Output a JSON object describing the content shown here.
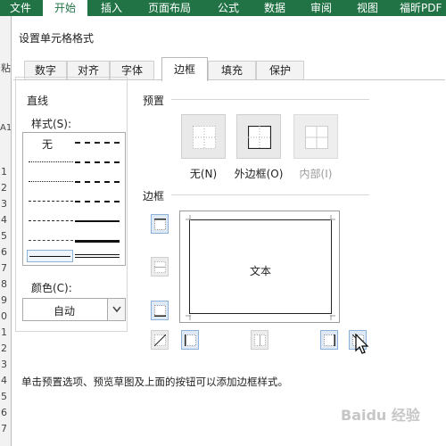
{
  "ribbon": {
    "file_tab": "文件",
    "tabs": [
      "开始",
      "插入",
      "页面布局",
      "公式",
      "数据",
      "审阅",
      "视图",
      "福昕PDF"
    ]
  },
  "sheet": {
    "name_box_fragment": "粘",
    "cell_ref_fragment": "A1",
    "row_numbers": [
      "1",
      "2",
      "3",
      "4",
      "5",
      "6",
      "7",
      "8",
      "9",
      "0",
      "1",
      "2",
      "3",
      "4",
      "5",
      "6",
      "7"
    ]
  },
  "dialog": {
    "title": "设置单元格格式",
    "tabs": [
      "数字",
      "对齐",
      "字体",
      "边框",
      "填充",
      "保护"
    ],
    "active_tab": "边框",
    "line_section": {
      "label": "直线",
      "style_label": "样式(S):",
      "style_none": "无",
      "color_label": "颜色(C):",
      "color_value": "自动"
    },
    "preset_section": {
      "label": "预置",
      "buttons": [
        {
          "label": "无(N)",
          "enabled": true
        },
        {
          "label": "外边框(O)",
          "enabled": true
        },
        {
          "label": "内部(I)",
          "enabled": false
        }
      ]
    },
    "border_section": {
      "label": "边框",
      "preview_text": "文本"
    },
    "hint": "单击预置选项、预览草图及上面的按钮可以添加边框样式。"
  },
  "watermark": "Baidu 经验",
  "colors": {
    "ribbon_green": "#217346",
    "button_blue_bg": "#dfe9f5",
    "button_blue_border": "#8db2da"
  }
}
